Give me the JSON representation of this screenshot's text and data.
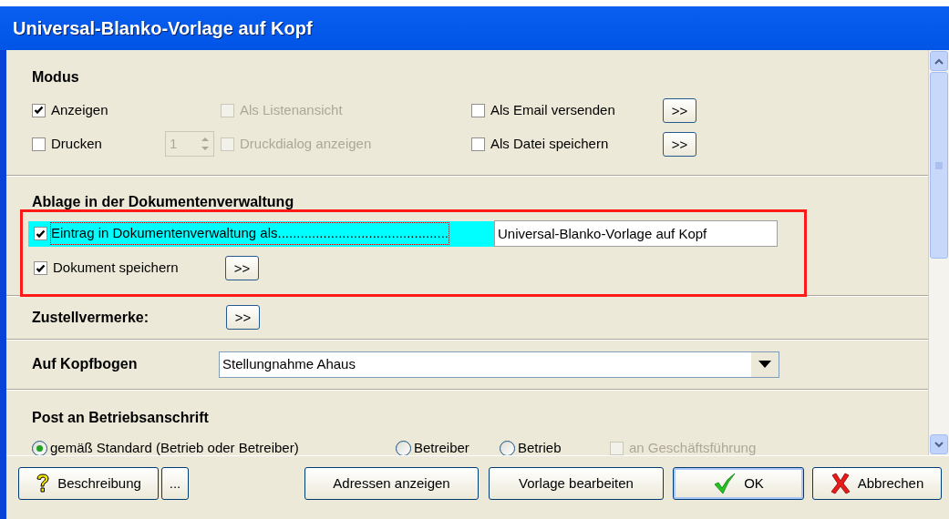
{
  "window": {
    "title": "Universal-Blanko-Vorlage auf Kopf"
  },
  "modus": {
    "heading": "Modus",
    "rows": [
      [
        {
          "label": "Anzeigen",
          "checked": true,
          "disabled": false
        },
        {
          "label": "Als Listenansicht",
          "checked": false,
          "disabled": true
        },
        {
          "label": "Als Email versenden",
          "checked": false,
          "disabled": false,
          "button": ">>"
        }
      ],
      [
        {
          "label": "Drucken",
          "checked": false,
          "disabled": false,
          "spinner": {
            "value": "1",
            "disabled": true
          }
        },
        {
          "label": "Druckdialog anzeigen",
          "checked": false,
          "disabled": true
        },
        {
          "label": "Als Datei speichern",
          "checked": false,
          "disabled": false,
          "button": ">>"
        }
      ]
    ]
  },
  "ablage": {
    "heading": "Ablage in der Dokumentenverwaltung",
    "entry": {
      "label": "Eintrag in Dokumentenverwaltung als.............................................",
      "checked": true,
      "focused": true,
      "value": "Universal-Blanko-Vorlage auf Kopf"
    },
    "save": {
      "label": "Dokument speichern",
      "checked": true,
      "button": ">>"
    }
  },
  "zustellvermerke": {
    "label": "Zustellvermerke:",
    "button": ">>"
  },
  "kopfbogen": {
    "label": "Auf Kopfbogen",
    "value": "Stellungnahme Ahaus"
  },
  "post": {
    "heading": "Post an Betriebsanschrift",
    "options": [
      {
        "label": "gemäß Standard (Betrieb oder Betreiber)",
        "selected": true
      },
      {
        "label": "Betreiber",
        "selected": false
      },
      {
        "label": "Betrieb",
        "selected": false
      }
    ],
    "extra": {
      "label": "an Geschäftsführung",
      "checked": false,
      "disabled": true
    }
  },
  "buttons": [
    {
      "label": "Beschreibung",
      "kind": "help",
      "default": false
    },
    {
      "label": "...",
      "kind": "more",
      "default": false
    },
    {
      "label": "Adressen anzeigen",
      "kind": "plain",
      "default": false
    },
    {
      "label": "Vorlage bearbeiten",
      "kind": "plain",
      "default": false
    },
    {
      "label": "OK",
      "kind": "ok",
      "default": true
    },
    {
      "label": "Abbrechen",
      "kind": "cancel",
      "default": false
    }
  ]
}
